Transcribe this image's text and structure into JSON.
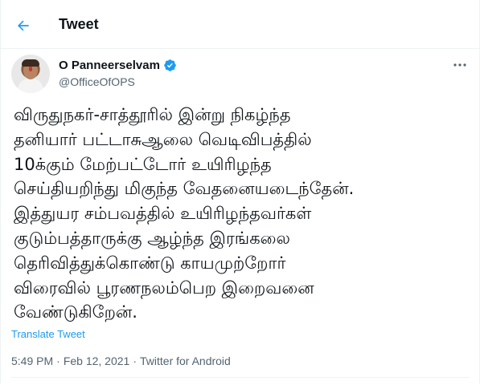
{
  "header": {
    "title": "Tweet"
  },
  "author": {
    "display_name": "O Panneerselvam",
    "handle": "@OfficeOfOPS",
    "verified": true
  },
  "tweet": {
    "text": "விருதுநகர்-சாத்தூரில் இன்று நிகழ்ந்த\nதனியார் பட்டாசுஆலை வெடிவிபத்தில்\n10க்கும் மேற்பட்டோர் உயிரிழந்த\nசெய்தியறிந்து மிகுந்த வேதனையடைந்தேன்.\nஇத்துயர சம்பவத்தில் உயிரிழந்தவர்கள்\nகுடும்பத்தாருக்கு ஆழ்ந்த இரங்கலை\nதெரிவித்துக்கொண்டு காயமுற்றோர்\nவிரைவில் பூரணநலம்பெற இறைவனை\nவேண்டுகிறேன்.",
    "translate_label": "Translate Tweet",
    "time": "5:49 PM",
    "separator": "·",
    "date": "Feb 12, 2021",
    "source": "Twitter for Android"
  },
  "icons": {
    "back": "arrow-left-icon",
    "verified": "verified-badge-icon",
    "more": "more-horizontal-icon"
  },
  "colors": {
    "accent": "#1d9bf0",
    "secondary_text": "#536471",
    "primary_text": "#0f1419"
  }
}
